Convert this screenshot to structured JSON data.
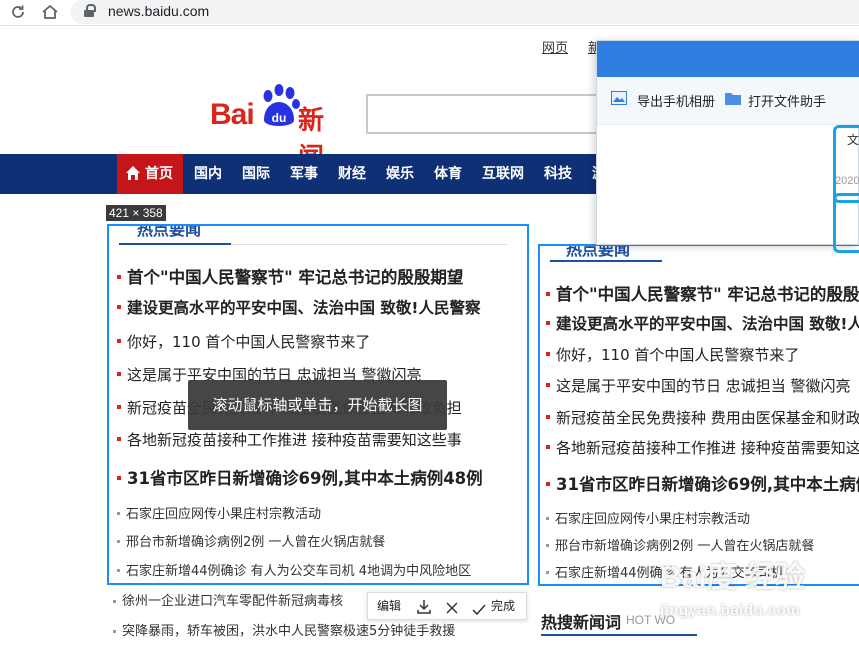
{
  "browser": {
    "url": "news.baidu.com",
    "back_icon": "refresh-icon",
    "home_icon": "home-icon"
  },
  "header": {
    "top_links": [
      "网页",
      "新"
    ],
    "logo": {
      "latin": "Bai",
      "paw_text": "du",
      "cn": "新闻"
    }
  },
  "nav": {
    "items": [
      "首页",
      "国内",
      "国际",
      "军事",
      "财经",
      "娱乐",
      "体育",
      "互联网",
      "科技",
      "游"
    ],
    "active_index": 0
  },
  "capture": {
    "size_label": "421 × 358",
    "tooltip": "滚动鼠标轴或单击，开始截长图"
  },
  "section": {
    "title": "热点要闻"
  },
  "headlines": {
    "bold": [
      "首个\"中国人民警察节\" 牢记总书记的殷殷期望",
      "建设更高水平的平安中国、法治中国 致敬!人民警察"
    ],
    "regular": [
      "你好，110 首个中国人民警察节来了",
      "这是属于平安中国的节日 忠诚担当 警徽闪亮",
      "新冠疫苗全民免费接种 费用由医保基金和财政负担",
      "各地新冠疫苗接种工作推进 接种疫苗需要知这些事"
    ],
    "bold2": "31省市区昨日新增确诊69例,其中本土病例48例",
    "small": [
      "石家庄回应网传小果庄村宗教活动",
      "邢台市新增确诊病例2例 一人曾在火锅店就餐",
      "石家庄新增44例确诊 有人为公交车司机 4地调为中风险地区"
    ],
    "outside": [
      "徐州一企业进口汽车零配件新冠病毒核",
      "突降暴雨，轿车被困，洪水中人民警察极速5分钟徒手救援"
    ]
  },
  "preview": {
    "title": "热点要闻",
    "bold": [
      "首个\"中国人民警察节\" 牢记总书记的殷殷期望",
      "建设更高水平的平安中国、法治中国 致敬!人"
    ],
    "regular": [
      "你好，110 首个中国人民警察节来了",
      "这是属于平安中国的节日 忠诚担当 警徽闪亮",
      "新冠疫苗全民免费接种 费用由医保基金和财政",
      "各地新冠疫苗接种工作推进 接种疫苗需要知这"
    ],
    "bold2": "31省市区昨日新增确诊69例,其中本土病例4",
    "small": [
      "石家庄回应网传小果庄村宗教活动",
      "邢台市新增确诊病例2例 一人曾在火锅店就餐",
      "石家庄新增44例确诊 有人为公交车司机"
    ]
  },
  "toolbar": {
    "edit": "编辑",
    "done": "完成"
  },
  "hot_search": {
    "title": "热搜新闻词",
    "subtitle": "HOT WO"
  },
  "popup": {
    "export_label": "导出手机相册",
    "open_label": "打开文件助手",
    "card_text": "文",
    "date": "2020"
  },
  "watermark": {
    "line1": "Bai度 经验",
    "line2": "jingyan.baidu.com"
  },
  "colors": {
    "nav_bg": "#0f3075",
    "nav_active": "#c3151a",
    "brand_red": "#d9251c",
    "capture_border": "#1a8cff"
  }
}
